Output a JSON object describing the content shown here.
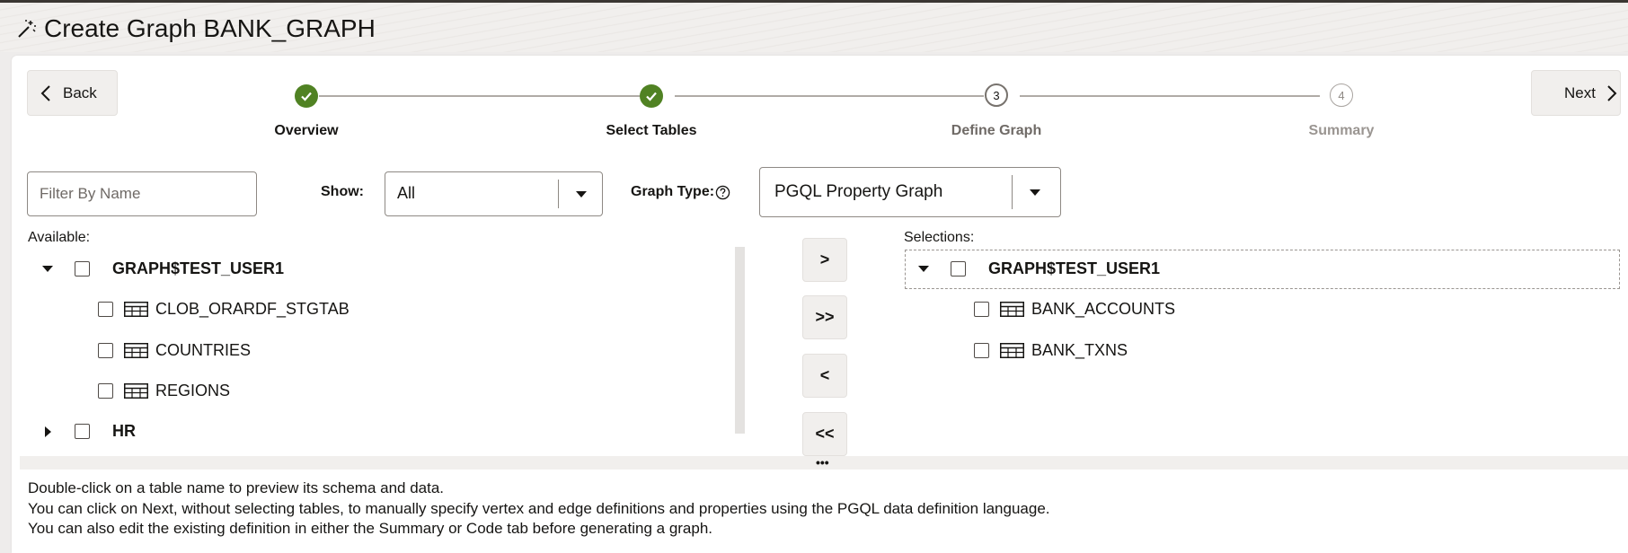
{
  "window": {
    "title": "Create Graph BANK_GRAPH"
  },
  "nav": {
    "back_label": "Back",
    "next_label": "Next"
  },
  "steps": [
    {
      "number": "",
      "label": "Overview",
      "state": "done"
    },
    {
      "number": "",
      "label": "Select Tables",
      "state": "done"
    },
    {
      "number": "3",
      "label": "Define Graph",
      "state": "current"
    },
    {
      "number": "4",
      "label": "Summary",
      "state": "future"
    }
  ],
  "filter": {
    "placeholder": "Filter By Name",
    "value": ""
  },
  "show": {
    "label": "Show:",
    "value": "All"
  },
  "graph_type": {
    "label": "Graph Type:",
    "value": "PGQL Property Graph"
  },
  "available": {
    "label": "Available:",
    "schemas": [
      {
        "name": "GRAPH$TEST_USER1",
        "expanded": true,
        "tables": [
          "CLOB_ORARDF_STGTAB",
          "COUNTRIES",
          "REGIONS"
        ]
      },
      {
        "name": "HR",
        "expanded": false,
        "tables": []
      }
    ]
  },
  "shuttle": {
    "move_selected": ">",
    "move_all": ">>",
    "remove_selected": "<",
    "remove_all": "<<"
  },
  "selections": {
    "label": "Selections:",
    "schema": "GRAPH$TEST_USER1",
    "tables": [
      "BANK_ACCOUNTS",
      "BANK_TXNS"
    ]
  },
  "help": [
    "Double-click on a table name to preview its schema and data.",
    "You can click on Next, without selecting tables, to manually specify vertex and edge definitions and properties using the PGQL data definition language.",
    "You can also edit the existing definition in either the Summary or Code tab before generating a graph."
  ],
  "splitter": {
    "handle": "•••"
  },
  "colors": {
    "done_step": "#508223",
    "panel_bg": "#ffffff",
    "button_bg": "#f1efed"
  },
  "icons": {
    "title": "magic-wand-icon",
    "back": "chevron-left-icon",
    "next": "chevron-right-icon",
    "step_done": "check-icon",
    "table": "table-icon",
    "help": "question-circle-icon",
    "dropdown": "caret-down-icon"
  }
}
